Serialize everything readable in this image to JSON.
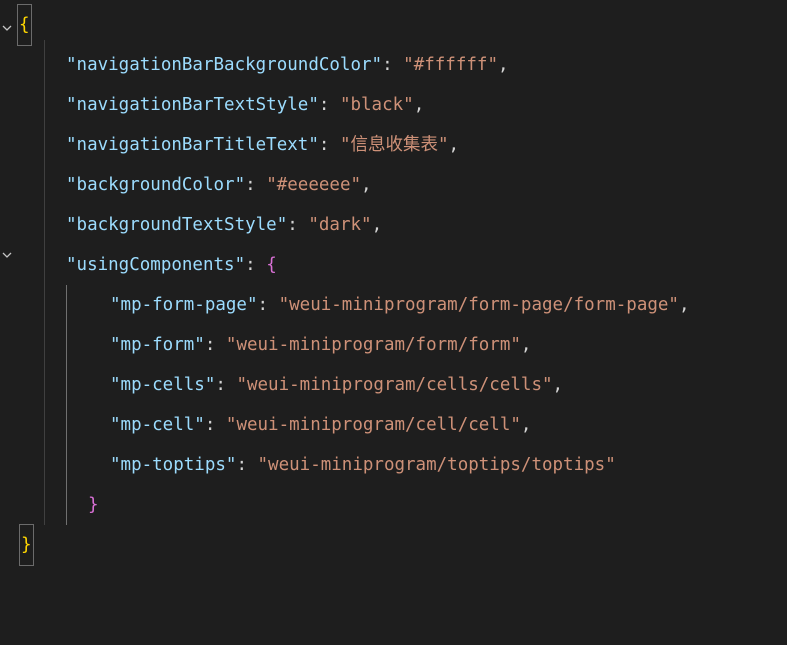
{
  "editor": {
    "language": "json",
    "file_hint": "",
    "colors": {
      "background": "#1e1e1e",
      "key": "#9cdcfe",
      "string": "#ce9178",
      "punctuation": "#d4d4d4",
      "bracket_outer": "#ffd700",
      "bracket_inner": "#da70d6"
    },
    "lines": [
      {
        "open": "{"
      },
      {
        "key": "\"navigationBarBackgroundColor\"",
        "sep": ": ",
        "value": "\"#ffffff\"",
        "end": ","
      },
      {
        "key": "\"navigationBarTextStyle\"",
        "sep": ": ",
        "value": "\"black\"",
        "end": ","
      },
      {
        "key": "\"navigationBarTitleText\"",
        "sep": ": ",
        "value": "\"信息收集表\"",
        "end": ","
      },
      {
        "key": "\"backgroundColor\"",
        "sep": ": ",
        "value": "\"#eeeeee\"",
        "end": ","
      },
      {
        "key": "\"backgroundTextStyle\"",
        "sep": ": ",
        "value": "\"dark\"",
        "end": ","
      },
      {
        "key": "\"usingComponents\"",
        "sep": ": ",
        "open": "{"
      },
      {
        "key": "\"mp-form-page\"",
        "sep": ": ",
        "value": "\"weui-miniprogram/form-page/form-page\"",
        "end": ","
      },
      {
        "key": "\"mp-form\"",
        "sep": ": ",
        "value": "\"weui-miniprogram/form/form\"",
        "end": ","
      },
      {
        "key": "\"mp-cells\"",
        "sep": ": ",
        "value": "\"weui-miniprogram/cells/cells\"",
        "end": ","
      },
      {
        "key": "\"mp-cell\"",
        "sep": ": ",
        "value": "\"weui-miniprogram/cell/cell\"",
        "end": ","
      },
      {
        "key": "\"mp-toptips\"",
        "sep": ": ",
        "value": "\"weui-miniprogram/toptips/toptips\"",
        "end": ""
      },
      {
        "close": "}"
      },
      {
        "close": "}"
      }
    ],
    "fold_icons": [
      "chevron-down-icon",
      "chevron-down-icon"
    ]
  }
}
